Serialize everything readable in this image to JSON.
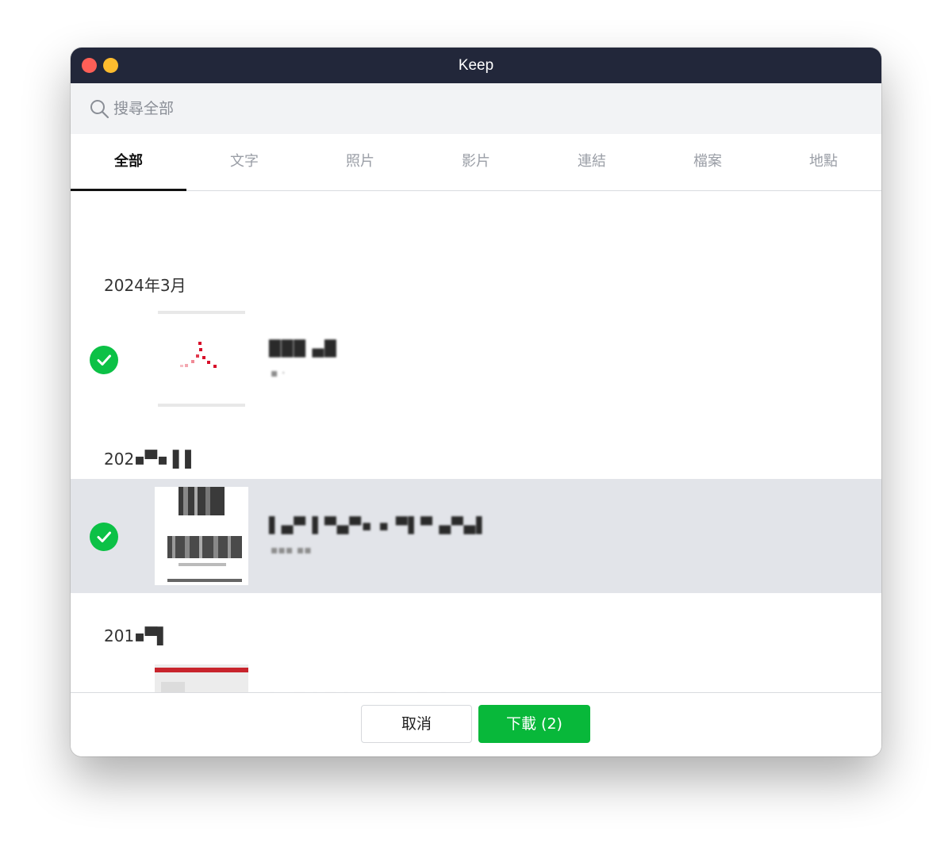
{
  "window": {
    "title": "Keep"
  },
  "search": {
    "placeholder": "搜尋全部",
    "icon": "search-icon"
  },
  "tabs": [
    {
      "label": "全部",
      "active": true
    },
    {
      "label": "文字",
      "active": false
    },
    {
      "label": "照片",
      "active": false
    },
    {
      "label": "影片",
      "active": false
    },
    {
      "label": "連結",
      "active": false
    },
    {
      "label": "檔案",
      "active": false
    },
    {
      "label": "地點",
      "active": false
    }
  ],
  "sections": [
    {
      "date": "2024年3月",
      "item": {
        "name": "███ ▄█",
        "meta": "▪ ·",
        "checked": true
      }
    },
    {
      "date": "202▪▀▪ ▌▌",
      "item": {
        "name": "▌▄▀ ▌▀▄▀▪ ▪ ▀▌▀ ▄▀▄▌",
        "meta": "▪▪▪ ▪▪",
        "checked": true
      }
    },
    {
      "date": "201▪▀▌",
      "item": {
        "name": "▌▄▀ ▌▀ ▌▪ ▀▀ ▄▀▄▌",
        "meta": "▪▪ ▀▄▀",
        "checked": false
      }
    }
  ],
  "footer": {
    "cancel_label": "取消",
    "download_label": "下載 (2)"
  },
  "colors": {
    "accent_green": "#0cc146",
    "titlebar": "#22273a",
    "selected_row": "#e2e4e9"
  }
}
